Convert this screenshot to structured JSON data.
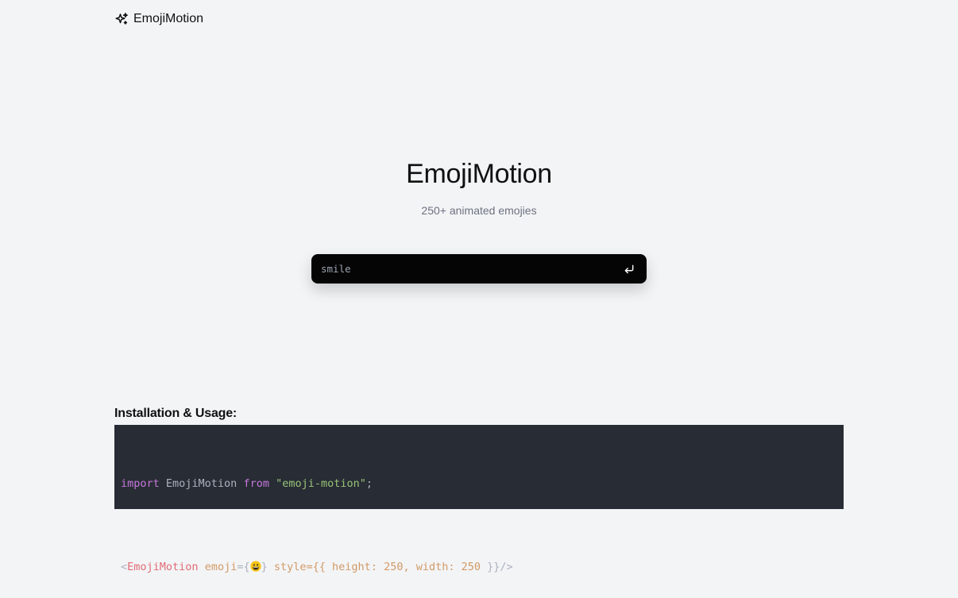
{
  "header": {
    "brand_name": "EmojiMotion",
    "brand_icon": "sparkles-icon"
  },
  "hero": {
    "title": "EmojiMotion",
    "subtitle": "250+ animated emojies"
  },
  "search": {
    "value": "",
    "placeholder": "smile",
    "submit_icon": "enter-return-icon"
  },
  "usage": {
    "heading": "Installation & Usage:",
    "line1": {
      "kw_import": "import",
      "name": " EmojiMotion ",
      "kw_from": "from",
      "space": " ",
      "module": "\"emoji-motion\"",
      "semicolon": ";"
    },
    "line2": {
      "open": "<",
      "component": "EmojiMotion",
      "space1": " ",
      "attr_emoji": "emoji",
      "eq_brace": "={",
      "emoji_icon": "grinning-face-icon",
      "close_brace": "}",
      "space2": " ",
      "attr_style": "style",
      "eq_style": "={{ ",
      "height_key": "height",
      "colon1": ": ",
      "height_val": "250",
      "comma": ", ",
      "width_key": "width",
      "colon2": ": ",
      "width_val": "250",
      "close": " }}/>"
    }
  },
  "colors": {
    "page_background": "#f3f4f6",
    "search_background": "#050505",
    "code_background": "#282c34",
    "keyword": "#c678dd",
    "string": "#98c379",
    "tag": "#e06c75",
    "attribute": "#d19a66"
  }
}
